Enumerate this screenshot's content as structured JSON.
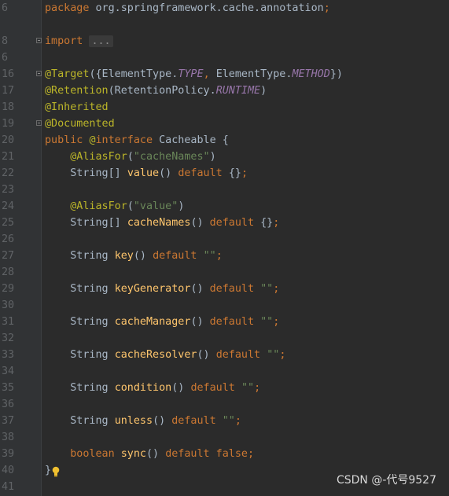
{
  "lines": [
    {
      "n": "6",
      "t": [
        [
          "kw",
          "package "
        ],
        [
          "plain",
          "org.springframework.cache.annotation"
        ],
        [
          "kw",
          ";"
        ]
      ]
    },
    {
      "n": "",
      "t": []
    },
    {
      "n": "8",
      "fold": true,
      "t": [
        [
          "kw",
          "import "
        ],
        [
          "folded",
          "..."
        ]
      ]
    },
    {
      "n": "",
      "t": []
    },
    {
      "n": "6",
      "t": []
    },
    {
      "n": "",
      "t": []
    },
    {
      "n": "16",
      "fold": true,
      "t": [
        [
          "ann",
          "@Target"
        ],
        [
          "plain",
          "({ElementType."
        ],
        [
          "it",
          "TYPE"
        ],
        [
          "kw",
          ", "
        ],
        [
          "plain",
          "ElementType."
        ],
        [
          "it",
          "METHOD"
        ],
        [
          "plain",
          "})"
        ]
      ]
    },
    {
      "n": "17",
      "t": [
        [
          "ann",
          "@Retention"
        ],
        [
          "plain",
          "(RetentionPolicy."
        ],
        [
          "it",
          "RUNTIME"
        ],
        [
          "plain",
          ")"
        ]
      ]
    },
    {
      "n": "18",
      "t": [
        [
          "ann",
          "@Inherited"
        ]
      ]
    },
    {
      "n": "19",
      "fold": true,
      "t": [
        [
          "ann",
          "@Documented"
        ]
      ]
    },
    {
      "n": "20",
      "t": [
        [
          "kw",
          "public "
        ],
        [
          "ann",
          "@"
        ],
        [
          "kw",
          "interface "
        ],
        [
          "plain",
          "Cacheable {"
        ]
      ]
    },
    {
      "n": "21",
      "t": [
        [
          "plain",
          "    "
        ],
        [
          "ann",
          "@AliasFor"
        ],
        [
          "plain",
          "("
        ],
        [
          "str",
          "\"cacheNames\""
        ],
        [
          "plain",
          ")"
        ]
      ]
    },
    {
      "n": "22",
      "t": [
        [
          "plain",
          "    String[] "
        ],
        [
          "fn",
          "value"
        ],
        [
          "plain",
          "() "
        ],
        [
          "kw",
          "default "
        ],
        [
          "plain",
          "{}"
        ],
        [
          "kw",
          ";"
        ]
      ]
    },
    {
      "n": "23",
      "t": []
    },
    {
      "n": "24",
      "t": [
        [
          "plain",
          "    "
        ],
        [
          "ann",
          "@AliasFor"
        ],
        [
          "plain",
          "("
        ],
        [
          "str",
          "\"value\""
        ],
        [
          "plain",
          ")"
        ]
      ]
    },
    {
      "n": "25",
      "t": [
        [
          "plain",
          "    String[] "
        ],
        [
          "fn",
          "cacheNames"
        ],
        [
          "plain",
          "() "
        ],
        [
          "kw",
          "default "
        ],
        [
          "plain",
          "{}"
        ],
        [
          "kw",
          ";"
        ]
      ]
    },
    {
      "n": "26",
      "t": []
    },
    {
      "n": "27",
      "t": [
        [
          "plain",
          "    String "
        ],
        [
          "fn",
          "key"
        ],
        [
          "plain",
          "() "
        ],
        [
          "kw",
          "default "
        ],
        [
          "str",
          "\"\""
        ],
        [
          "kw",
          ";"
        ]
      ]
    },
    {
      "n": "28",
      "t": []
    },
    {
      "n": "29",
      "t": [
        [
          "plain",
          "    String "
        ],
        [
          "fn",
          "keyGenerator"
        ],
        [
          "plain",
          "() "
        ],
        [
          "kw",
          "default "
        ],
        [
          "str",
          "\"\""
        ],
        [
          "kw",
          ";"
        ]
      ]
    },
    {
      "n": "30",
      "t": []
    },
    {
      "n": "31",
      "t": [
        [
          "plain",
          "    String "
        ],
        [
          "fn",
          "cacheManager"
        ],
        [
          "plain",
          "() "
        ],
        [
          "kw",
          "default "
        ],
        [
          "str",
          "\"\""
        ],
        [
          "kw",
          ";"
        ]
      ]
    },
    {
      "n": "32",
      "t": []
    },
    {
      "n": "33",
      "t": [
        [
          "plain",
          "    String "
        ],
        [
          "fn",
          "cacheResolver"
        ],
        [
          "plain",
          "() "
        ],
        [
          "kw",
          "default "
        ],
        [
          "str",
          "\"\""
        ],
        [
          "kw",
          ";"
        ]
      ]
    },
    {
      "n": "34",
      "t": []
    },
    {
      "n": "35",
      "t": [
        [
          "plain",
          "    String "
        ],
        [
          "fn",
          "condition"
        ],
        [
          "plain",
          "() "
        ],
        [
          "kw",
          "default "
        ],
        [
          "str",
          "\"\""
        ],
        [
          "kw",
          ";"
        ]
      ]
    },
    {
      "n": "36",
      "t": []
    },
    {
      "n": "37",
      "t": [
        [
          "plain",
          "    String "
        ],
        [
          "fn",
          "unless"
        ],
        [
          "plain",
          "() "
        ],
        [
          "kw",
          "default "
        ],
        [
          "str",
          "\"\""
        ],
        [
          "kw",
          ";"
        ]
      ]
    },
    {
      "n": "38",
      "t": []
    },
    {
      "n": "39",
      "t": [
        [
          "plain",
          "    "
        ],
        [
          "kw",
          "boolean "
        ],
        [
          "fn",
          "sync"
        ],
        [
          "plain",
          "() "
        ],
        [
          "kw",
          "default false;"
        ]
      ]
    },
    {
      "n": "40",
      "t": [
        [
          "plain",
          "}"
        ]
      ]
    },
    {
      "n": "41",
      "t": []
    }
  ],
  "watermark": "CSDN @-代号9527",
  "colors": {
    "background": "#2b2b2b",
    "gutter": "#313335",
    "keyword": "#cc7832",
    "annotation": "#bbb529",
    "string": "#6a8759",
    "method": "#ffc66d",
    "constant": "#9876aa"
  }
}
